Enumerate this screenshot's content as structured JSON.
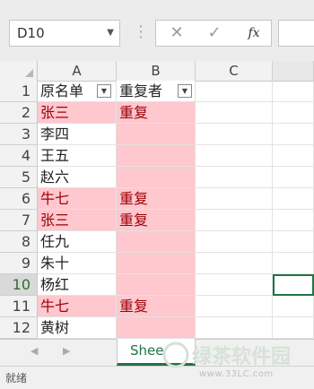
{
  "formula_bar": {
    "name_box": "D10",
    "cancel_icon": "✕",
    "confirm_icon": "✓",
    "fx_label": "fx"
  },
  "columns": [
    "A",
    "B",
    "C"
  ],
  "rows": [
    {
      "num": "1",
      "a": "原名单",
      "b": "重复者",
      "header": true
    },
    {
      "num": "2",
      "a": "张三",
      "b": "重复",
      "dup": true
    },
    {
      "num": "3",
      "a": "李四",
      "b": ""
    },
    {
      "num": "4",
      "a": "王五",
      "b": ""
    },
    {
      "num": "5",
      "a": "赵六",
      "b": ""
    },
    {
      "num": "6",
      "a": "牛七",
      "b": "重复",
      "dup": true
    },
    {
      "num": "7",
      "a": "张三",
      "b": "重复",
      "dup": true
    },
    {
      "num": "8",
      "a": "任九",
      "b": ""
    },
    {
      "num": "9",
      "a": "朱十",
      "b": ""
    },
    {
      "num": "10",
      "a": "杨红",
      "b": "",
      "active": true
    },
    {
      "num": "11",
      "a": "牛七",
      "b": "重复",
      "dup": true
    },
    {
      "num": "12",
      "a": "黄树",
      "b": ""
    }
  ],
  "sheet_tab": "Shee",
  "status_text": "就绪",
  "watermark": {
    "logo_text": "绿茶软件园",
    "url": "www.33LC.com"
  },
  "colors": {
    "accent": "#217346",
    "dup_fill": "#ffc7ce",
    "dup_text": "#9c0006"
  }
}
